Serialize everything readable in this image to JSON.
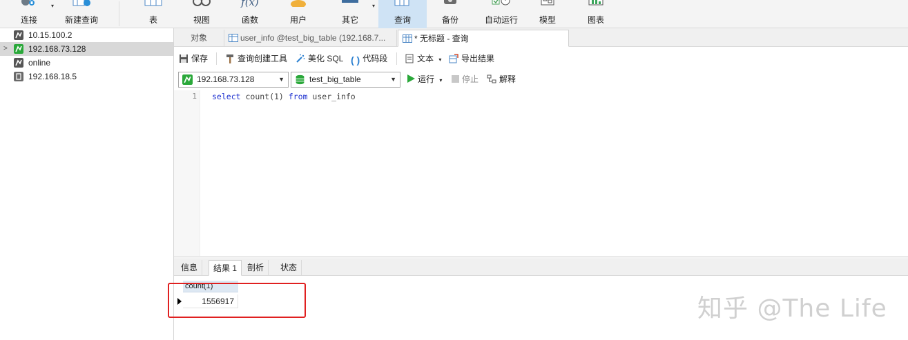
{
  "toolbar": {
    "items": [
      {
        "label": "连接",
        "icon": "connect-icon"
      },
      {
        "label": "新建查询",
        "icon": "new-query-icon"
      },
      {
        "label": "表",
        "icon": "table-icon"
      },
      {
        "label": "视图",
        "icon": "view-icon"
      },
      {
        "label": "函数",
        "icon": "function-icon",
        "glyph": "f(x)"
      },
      {
        "label": "用户",
        "icon": "user-icon"
      },
      {
        "label": "其它",
        "icon": "other-icon"
      },
      {
        "label": "查询",
        "icon": "query-icon",
        "active": true
      },
      {
        "label": "备份",
        "icon": "backup-icon"
      },
      {
        "label": "自动运行",
        "icon": "auto-run-icon"
      },
      {
        "label": "模型",
        "icon": "model-icon"
      },
      {
        "label": "图表",
        "icon": "chart-icon"
      }
    ]
  },
  "connections": [
    {
      "name": "10.15.100.2",
      "icon": "mysql-icon",
      "status": "closed"
    },
    {
      "name": "192.168.73.128",
      "icon": "mysql-icon",
      "status": "open",
      "selected": true
    },
    {
      "name": "online",
      "icon": "mysql-icon",
      "status": "closed"
    },
    {
      "name": "192.168.18.5",
      "icon": "mysql-icon",
      "status": "closed"
    }
  ],
  "tabs": [
    {
      "label": "对象"
    },
    {
      "label": "user_info @test_big_table (192.168.7..."
    },
    {
      "label": "* 无标题 - 查询",
      "active": true
    }
  ],
  "query_toolbar": {
    "save": "保存",
    "query_builder": "查询创建工具",
    "beautify": "美化 SQL",
    "snippet": "代码段",
    "text": "文本",
    "export": "导出结果"
  },
  "selectors": {
    "connection": "192.168.73.128",
    "database": "test_big_table",
    "run": "运行",
    "stop": "停止",
    "explain": "解释"
  },
  "editor": {
    "line_number": "1",
    "kw_select": "select",
    "fn_part": " count(1) ",
    "kw_from": "from",
    "table_part": " user_info"
  },
  "result_tabs": [
    {
      "label": "信息"
    },
    {
      "label": "结果 1",
      "active": true
    },
    {
      "label": "剖析"
    },
    {
      "label": "状态"
    }
  ],
  "result_grid": {
    "columns": [
      "count(1)"
    ],
    "rows": [
      [
        "1556917"
      ]
    ]
  },
  "watermark": "知乎 @The Life",
  "colors": {
    "active_toolbar": "#cfe3f5",
    "highlight_border": "#e02020",
    "keyword": "#1c2fcf",
    "mysql_green": "#2aa83a"
  }
}
